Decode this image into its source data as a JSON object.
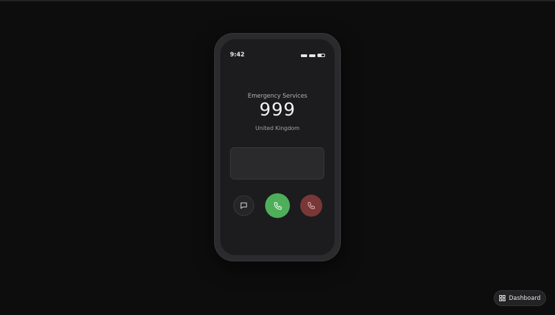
{
  "status_bar": {
    "time": "9:42"
  },
  "caller": {
    "label": "Emergency Services",
    "number": "999",
    "region": "United Kingdom"
  },
  "actions": {
    "message_icon": "message-icon",
    "call_icon": "phone-icon",
    "end_icon": "phone-end-icon"
  },
  "dashboard_button": {
    "label": "Dashboard",
    "icon": "grid-icon"
  },
  "colors": {
    "call_green": "#4fae5a",
    "end_red": "#7a3737",
    "background": "#0d0d0e"
  }
}
